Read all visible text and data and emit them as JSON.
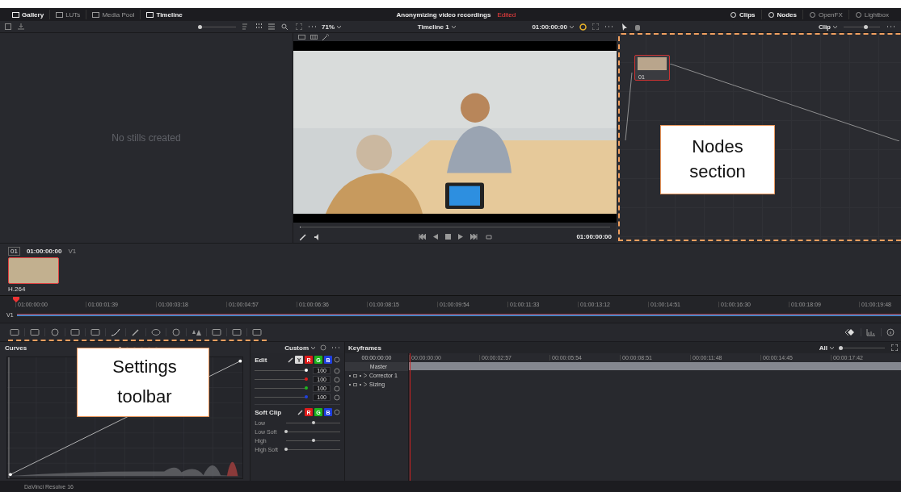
{
  "top_bar": {
    "left_tabs": [
      {
        "label": "Gallery",
        "active": true
      },
      {
        "label": "LUTs",
        "active": false
      },
      {
        "label": "Media Pool",
        "active": false
      },
      {
        "label": "Timeline",
        "active": true
      }
    ],
    "title": "Anonymizing video recordings",
    "status": "Edited",
    "right_tabs": [
      {
        "label": "Clips",
        "active": true
      },
      {
        "label": "Nodes",
        "active": true
      },
      {
        "label": "OpenFX",
        "active": false
      },
      {
        "label": "Lightbox",
        "active": false
      }
    ]
  },
  "toolbar": {
    "zoom": "71%",
    "timeline": "Timeline 1",
    "timecode": "01:00:00:00",
    "node_mode": "Clip",
    "thumb_slider": {
      "level": 0
    },
    "node_zoom": {
      "level": 0.6
    }
  },
  "gallery": {
    "empty_text": "No stills created"
  },
  "viewer": {
    "timecode": "01:00:00:00"
  },
  "node": {
    "label": "01"
  },
  "clip": {
    "number": "01",
    "timecode": "01:00:00:00",
    "track": "V1",
    "codec": "H.264"
  },
  "timeline": {
    "track": "V1",
    "ticks": [
      "01:00:00:00",
      "01:00:01:39",
      "01:00:03:18",
      "01:00:04:57",
      "01:00:06:36",
      "01:00:08:15",
      "01:00:09:54",
      "01:00:11:33",
      "01:00:13:12",
      "01:00:14:51",
      "01:00:16:30",
      "01:00:18:09",
      "01:00:19:48"
    ]
  },
  "curves": {
    "title": "Curves",
    "mode": "Custom"
  },
  "edit": {
    "title": "Edit",
    "channels": [
      {
        "label": "Y",
        "color": "#d9d9d9",
        "selected": true
      },
      {
        "label": "R",
        "color": "#e01b1b",
        "selected": false
      },
      {
        "label": "G",
        "color": "#1fb51f",
        "selected": false
      },
      {
        "label": "B",
        "color": "#1f3fe0",
        "selected": false
      }
    ],
    "sliders": [
      {
        "value": "100",
        "color": "#ffffff",
        "level": 1
      },
      {
        "value": "100",
        "color": "#e01b1b",
        "level": 1
      },
      {
        "value": "100",
        "color": "#1fb51f",
        "level": 1
      },
      {
        "value": "100",
        "color": "#1f3fe0",
        "level": 1
      }
    ],
    "soft_clip": {
      "title": "Soft Clip",
      "channels": [
        {
          "label": "R",
          "color": "#e01b1b"
        },
        {
          "label": "G",
          "color": "#1fb51f"
        },
        {
          "label": "B",
          "color": "#1f3fe0"
        }
      ],
      "sliders": [
        {
          "label": "Low",
          "level": 0.5
        },
        {
          "label": "Low Soft",
          "level": 0
        },
        {
          "label": "High",
          "level": 0.5
        },
        {
          "label": "High Soft",
          "level": 0
        }
      ]
    }
  },
  "keyframes": {
    "title": "Keyframes",
    "filter": "All",
    "zoom": {
      "level": 0
    },
    "timecode": "00:00:00:00",
    "ticks": [
      "00:00:00:00",
      "00:00:02:57",
      "00:00:05:54",
      "00:00:08:51",
      "00:00:11:48",
      "00:00:14:45",
      "00:00:17:42"
    ],
    "tracks": [
      {
        "label": "Master"
      },
      {
        "label": "Corrector 1"
      },
      {
        "label": "Sizing"
      }
    ]
  },
  "callouts": [
    {
      "lines": [
        "Nodes",
        "section"
      ],
      "kind": "nodes"
    },
    {
      "lines": [
        "Settings",
        "toolbar"
      ],
      "kind": "settings"
    }
  ],
  "status_bar": {
    "app": "DaVinci Resolve 16"
  }
}
